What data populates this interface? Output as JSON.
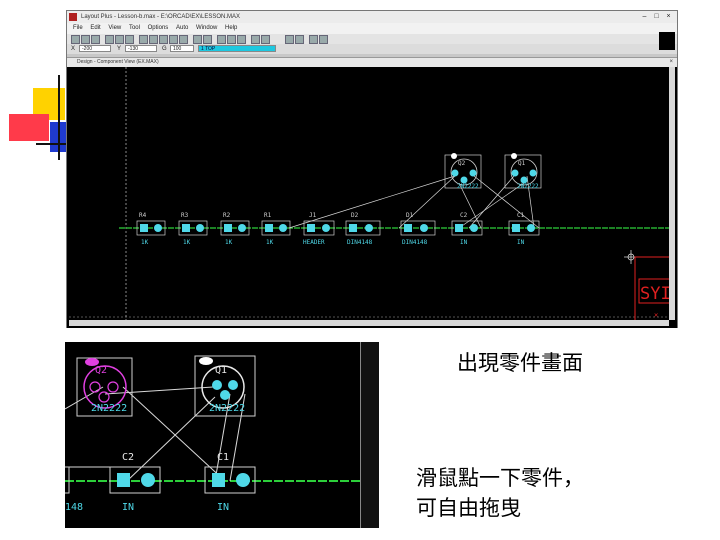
{
  "window": {
    "title": "Layout Plus - Lesson-b.max - E:\\ORCAD\\EX\\LESSON.MAX",
    "menu": [
      "File",
      "Edit",
      "View",
      "Tool",
      "Options",
      "Auto",
      "Window",
      "Help"
    ],
    "coords": {
      "x_label": "X",
      "x_value": "-200",
      "y_label": "Y",
      "y_value": "-130",
      "g_label": "G",
      "g_value": "100",
      "layer": "1 TOP"
    }
  },
  "subwindow": {
    "title": "Design - Component View (EX.MAX)"
  },
  "components": {
    "resistors": [
      {
        "ref": "R4",
        "value": "1K"
      },
      {
        "ref": "R3",
        "value": "1K"
      },
      {
        "ref": "R2",
        "value": "1K"
      },
      {
        "ref": "R1",
        "value": "1K"
      }
    ],
    "j1": {
      "ref": "J1",
      "value": "HEADER"
    },
    "d2": {
      "ref": "D2",
      "value": "DIN4148"
    },
    "d1": {
      "ref": "D1",
      "value": "DIN4148"
    },
    "c2": {
      "ref": "C2",
      "value": "IN"
    },
    "c1": {
      "ref": "C1",
      "value": "IN"
    },
    "q2": {
      "ref": "Q2",
      "value": "2N2222"
    },
    "q1": {
      "ref": "Q1",
      "value": "2N2222"
    },
    "sym_label": "SYI"
  },
  "zoom": {
    "q2": {
      "ref": "Q2",
      "value": "2N2222"
    },
    "q1": {
      "ref": "Q1",
      "value": "2N2222"
    },
    "c2": {
      "ref": "C2",
      "value": "IN"
    },
    "c1": {
      "ref": "C1",
      "value": "IN"
    },
    "left_value": "148"
  },
  "captions": {
    "appear": "出現零件畫面",
    "drag_line1": "滑鼠點一下零件，",
    "drag_line2": "可自由拖曳"
  },
  "colors": {
    "part": "#4fd8e8",
    "outline": "#cfcfcf",
    "net": "#2ccf3a",
    "selected": "#e040e0",
    "sym": "#e02020"
  }
}
